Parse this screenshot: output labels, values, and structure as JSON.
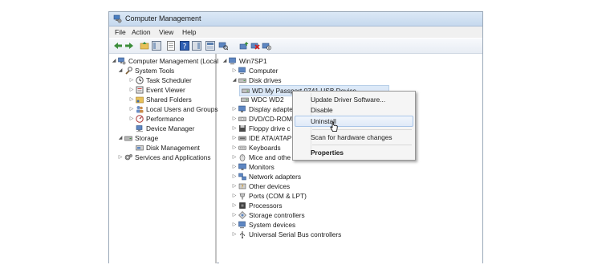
{
  "window": {
    "title": "Computer Management"
  },
  "menu": {
    "file": "File",
    "action": "Action",
    "view": "View",
    "help": "Help"
  },
  "left_tree": {
    "root": "Computer Management (Local",
    "system_tools": "System Tools",
    "task_scheduler": "Task Scheduler",
    "event_viewer": "Event Viewer",
    "shared_folders": "Shared Folders",
    "local_users": "Local Users and Groups",
    "performance": "Performance",
    "device_manager": "Device Manager",
    "storage": "Storage",
    "disk_management": "Disk Management",
    "services": "Services and Applications"
  },
  "device_tree": {
    "root": "Win7SP1",
    "computer": "Computer",
    "disk_drives": "Disk drives",
    "wd_passport": "WD My Passport 0741 USB Device",
    "wdc": "WDC WD2",
    "display": "Display adapte",
    "dvd": "DVD/CD-ROM",
    "floppy": "Floppy drive c",
    "ide": "IDE ATA/ATAP",
    "keyboards": "Keyboards",
    "mice": "Mice and othe",
    "monitors": "Monitors",
    "network": "Network adapters",
    "other": "Other devices",
    "ports": "Ports (COM & LPT)",
    "processors": "Processors",
    "storage_ctrl": "Storage controllers",
    "system_devices": "System devices",
    "usb": "Universal Serial Bus controllers"
  },
  "context_menu": {
    "update": "Update Driver Software...",
    "disable": "Disable",
    "uninstall": "Uninstall",
    "scan": "Scan for hardware changes",
    "properties": "Properties"
  }
}
